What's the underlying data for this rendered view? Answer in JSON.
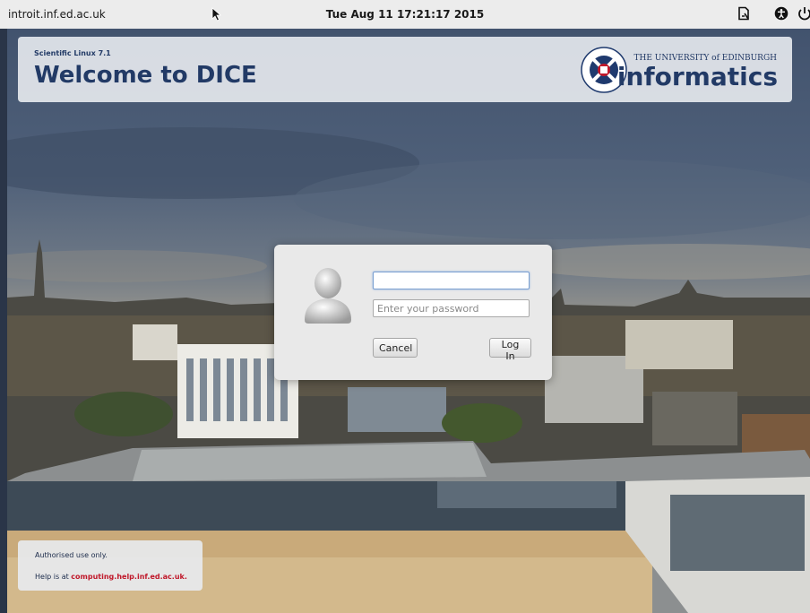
{
  "topbar": {
    "hostname": "introit.inf.ed.ac.uk",
    "clock": "Tue Aug 11 17:21:17 2015",
    "icons": [
      "keyboard-layout-icon",
      "accessibility-icon",
      "power-icon"
    ]
  },
  "banner": {
    "os_label": "Scientific Linux 7.1",
    "welcome": "Welcome to DICE",
    "university": "THE UNIVERSITY of EDINBURGH",
    "school": "informatics"
  },
  "login": {
    "username_value": "",
    "password_placeholder": "Enter your password",
    "cancel_label": "Cancel",
    "login_label": "Log In"
  },
  "notice": {
    "line1": "Authorised use only.",
    "line2_prefix": "Help is at ",
    "link": "computing.help.inf.ed.ac.uk."
  },
  "colors": {
    "brand_navy": "#223a66",
    "link_red": "#c0182a",
    "topbar_bg": "#ececec"
  }
}
